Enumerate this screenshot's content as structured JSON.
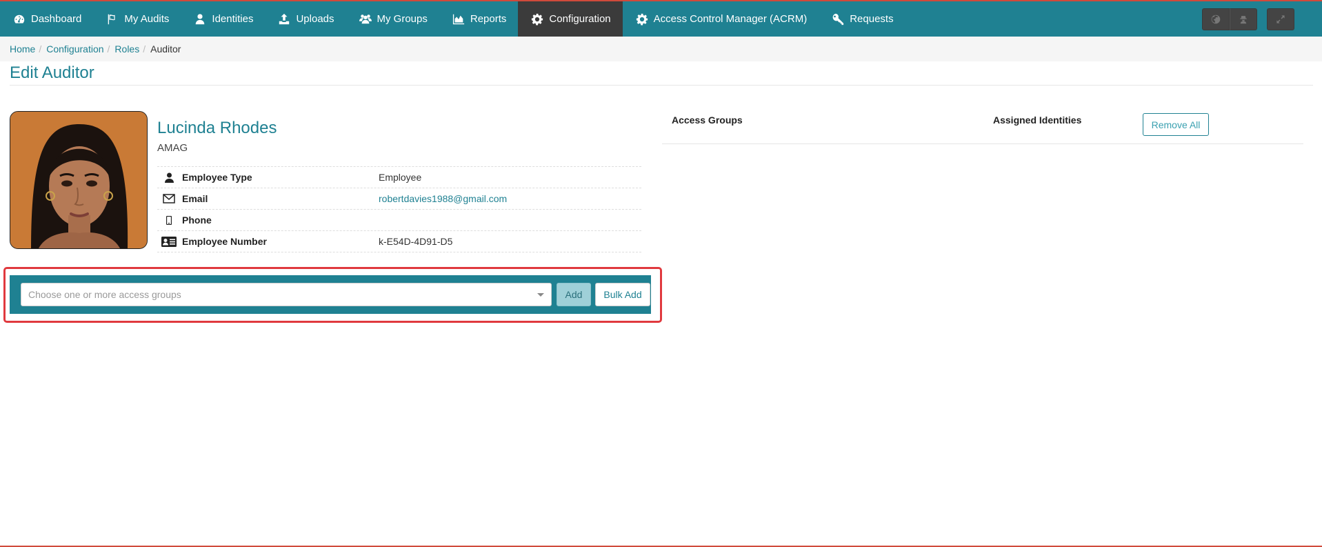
{
  "nav": {
    "items": [
      {
        "label": "Dashboard",
        "icon": "dashboard-icon"
      },
      {
        "label": "My Audits",
        "icon": "flag-icon"
      },
      {
        "label": "Identities",
        "icon": "user-icon"
      },
      {
        "label": "Uploads",
        "icon": "upload-icon"
      },
      {
        "label": "My Groups",
        "icon": "users-icon"
      },
      {
        "label": "Reports",
        "icon": "area-chart-icon"
      },
      {
        "label": "Configuration",
        "icon": "gear-icon",
        "active": true
      },
      {
        "label": "Access Control Manager (ACRM)",
        "icon": "gear-icon"
      },
      {
        "label": "Requests",
        "icon": "key-icon"
      }
    ],
    "right_buttons": [
      "globe-icon",
      "user-secret-icon",
      "expand-icon"
    ]
  },
  "breadcrumb": {
    "home": "Home",
    "configuration": "Configuration",
    "roles": "Roles",
    "current": "Auditor",
    "separator": "/"
  },
  "page": {
    "title": "Edit Auditor"
  },
  "profile": {
    "name": "Lucinda Rhodes",
    "org": "AMAG",
    "fields": {
      "employee_type_label": "Employee Type",
      "employee_type_value": "Employee",
      "email_label": "Email",
      "email_value": "robertdavies1988@gmail.com",
      "phone_label": "Phone",
      "phone_value": "",
      "employee_number_label": "Employee Number",
      "employee_number_value": "k-E54D-4D91-D5"
    }
  },
  "add_groups": {
    "placeholder": "Choose one or more access groups",
    "add_label": "Add",
    "bulk_add_label": "Bulk Add"
  },
  "groups_table": {
    "col_access_groups": "Access Groups",
    "col_assigned_identities": "Assigned Identities",
    "remove_all_label": "Remove All"
  },
  "colors": {
    "brand": "#1f8192",
    "active_nav": "#3b3b3b",
    "highlight": "#e0393e"
  }
}
